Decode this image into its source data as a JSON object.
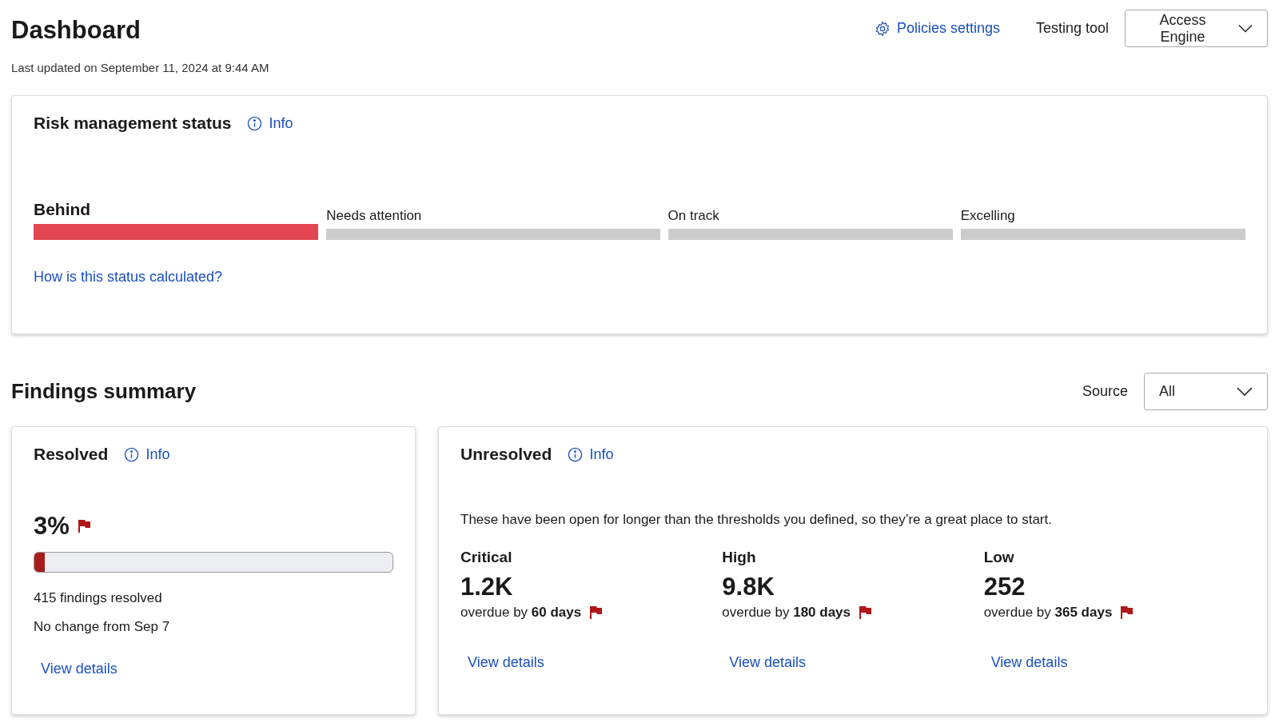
{
  "header": {
    "title": "Dashboard",
    "updated": "Last updated on September 11, 2024 at 9:44 AM",
    "policies_link": "Policies settings",
    "tool_label": "Testing tool",
    "tool_value": "Access Engine"
  },
  "risk": {
    "title": "Risk management status",
    "info": "Info",
    "link": "How is this status calculated?",
    "segments": [
      {
        "label": "Behind",
        "selected": true
      },
      {
        "label": "Needs attention",
        "selected": false
      },
      {
        "label": "On track",
        "selected": false
      },
      {
        "label": "Excelling",
        "selected": false
      }
    ]
  },
  "findings": {
    "title": "Findings summary",
    "source_label": "Source",
    "source_value": "All",
    "resolved": {
      "title": "Resolved",
      "info": "Info",
      "percent": "3%",
      "flagged": true,
      "level": 0.03,
      "count": "415 findings resolved",
      "change": "No change from Sep 7",
      "link": "View details"
    },
    "unresolved": {
      "title": "Unresolved",
      "info": "Info",
      "description": "These have been open for longer than the thresholds you defined, so they’re a great place to start.",
      "groups": [
        {
          "label": "Critical",
          "value": "1.2K",
          "overdue": "overdue by **60 days**",
          "flagged": true,
          "link": "View details"
        },
        {
          "label": "High",
          "value": "9.8K",
          "overdue": "overdue by **180 days**",
          "flagged": true,
          "link": "View details"
        },
        {
          "label": "Low",
          "value": "252",
          "overdue": "overdue by **365 days**",
          "flagged": true,
          "link": "View details"
        }
      ]
    }
  }
}
